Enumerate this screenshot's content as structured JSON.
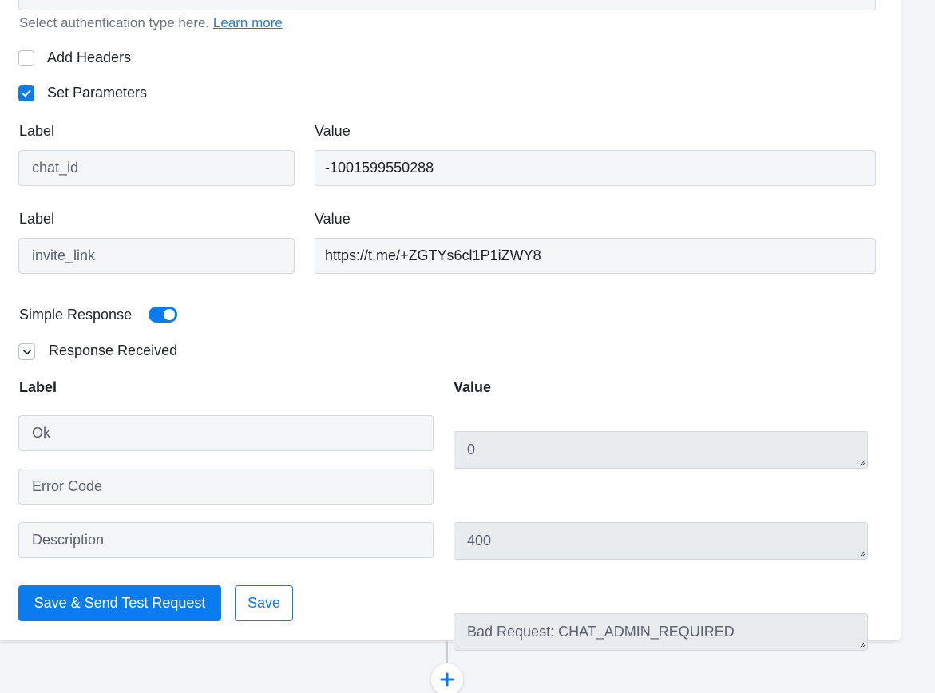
{
  "auth": {
    "helper_text": "Select authentication type here.",
    "learn_more": "Learn more"
  },
  "options": {
    "add_headers": {
      "label": "Add Headers",
      "checked": false
    },
    "set_parameters": {
      "label": "Set Parameters",
      "checked": true
    }
  },
  "parameters": [
    {
      "label_title": "Label",
      "value_title": "Value",
      "label": "chat_id",
      "value": "-1001599550288"
    },
    {
      "label_title": "Label",
      "value_title": "Value",
      "label": "invite_link",
      "value": "https://t.me/+ZGTYs6cl1P1iZWY8"
    }
  ],
  "simple_response": {
    "label": "Simple Response",
    "enabled": true
  },
  "response": {
    "title": "Response Received",
    "label_header": "Label",
    "value_header": "Value",
    "rows": [
      {
        "label": "Ok",
        "value": "0"
      },
      {
        "label": "Error Code",
        "value": "400"
      },
      {
        "label": "Description",
        "value": "Bad Request: CHAT_ADMIN_REQUIRED"
      }
    ]
  },
  "buttons": {
    "save_send": "Save & Send Test Request",
    "save": "Save"
  },
  "colors": {
    "primary": "#0a7cf0",
    "link": "#1d7fd1",
    "background": "#f3f5f8"
  },
  "icons": {
    "checkbox_check": "check-icon",
    "collapse": "chevron-down-icon",
    "add_step": "plus-icon"
  }
}
